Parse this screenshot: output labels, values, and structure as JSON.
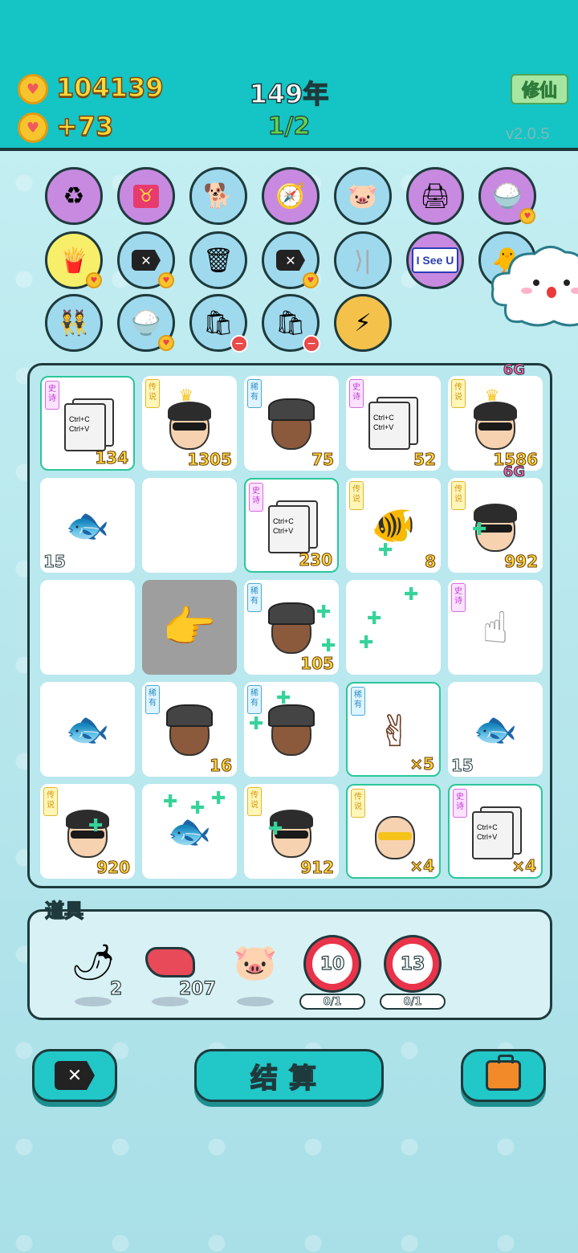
{
  "header": {
    "coins": "104139",
    "income": "+73",
    "year": "149年",
    "progress": "1/2",
    "cultivate_label": "修仙",
    "version": "v2.0.5"
  },
  "skills": {
    "row1": [
      "recycle-icon",
      "bull-card-icon",
      "dog-icon",
      "compass-icon",
      "piggy-bank-icon",
      "printer-icon",
      "rice-bowl-icon"
    ],
    "row2": [
      "fries-icon",
      "delete-tag-icon",
      "trash-bag-recycle-icon",
      "delete-tag-icon",
      "skip-icon",
      "i-see-u-card",
      "chick-icon"
    ],
    "row3": [
      "twins-icon",
      "rice-bowl-icon",
      "trash-bag-minus-icon",
      "trash-bag-minus-icon",
      "lightning-icon"
    ],
    "iseeu_text": "I See U"
  },
  "board": {
    "tags": {
      "legend": "传说",
      "epic": "史诗",
      "rare": "稀有"
    },
    "doc_text": "Ctrl+C\nCtrl+V",
    "sixg": "6G",
    "values": {
      "r0c0": "134",
      "r0c1": "1305",
      "r0c2": "75",
      "r0c3": "52",
      "r0c4": "1586",
      "r1c0": "15",
      "r1c2": "230",
      "r1c3": "8",
      "r1c4": "992",
      "r2c2": "105",
      "r3c1": "16",
      "r3c3": "×5",
      "r3c4": "15",
      "r4c0": "920",
      "r4c2": "912",
      "r4c3": "×4",
      "r4c4": "×4"
    }
  },
  "items": {
    "title": "道具",
    "pepper_count": "2",
    "liver_count": "207",
    "target1_value": "10",
    "target1_progress": "0/1",
    "target2_value": "13",
    "target2_progress": "0/1"
  },
  "buttons": {
    "settle_label": "结算"
  },
  "colors": {
    "header": "#15c4c4",
    "accent_gold": "#ffd93b",
    "border": "#1e3a3c",
    "highlight": "#2bc79a"
  }
}
